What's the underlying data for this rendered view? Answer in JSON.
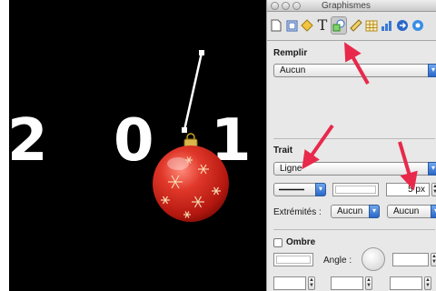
{
  "canvas": {
    "digits": [
      "2",
      "0",
      "1"
    ]
  },
  "panel": {
    "title": "Graphismes",
    "toolbar_icons": [
      "document-icon",
      "layout-icon",
      "shape-icon",
      "text-icon",
      "graphic-icon",
      "ruler-icon",
      "table-icon",
      "chart-icon",
      "link-icon",
      "info-icon"
    ],
    "fill": {
      "heading": "Remplir",
      "value": "Aucun"
    },
    "stroke": {
      "heading": "Trait",
      "type_value": "Ligne",
      "width_value": "5 px",
      "endpoints_label": "Extrémités :",
      "endpoint_start": "Aucun",
      "endpoint_end": "Aucun"
    },
    "shadow": {
      "checkbox_label": "Ombre",
      "angle_label": "Angle :"
    }
  },
  "colors": {
    "annotation_arrow": "#e8294b",
    "ornament_red": "#d42a1e",
    "cap_gold": "#c9a227",
    "popup_accent": "#2a67c8"
  }
}
